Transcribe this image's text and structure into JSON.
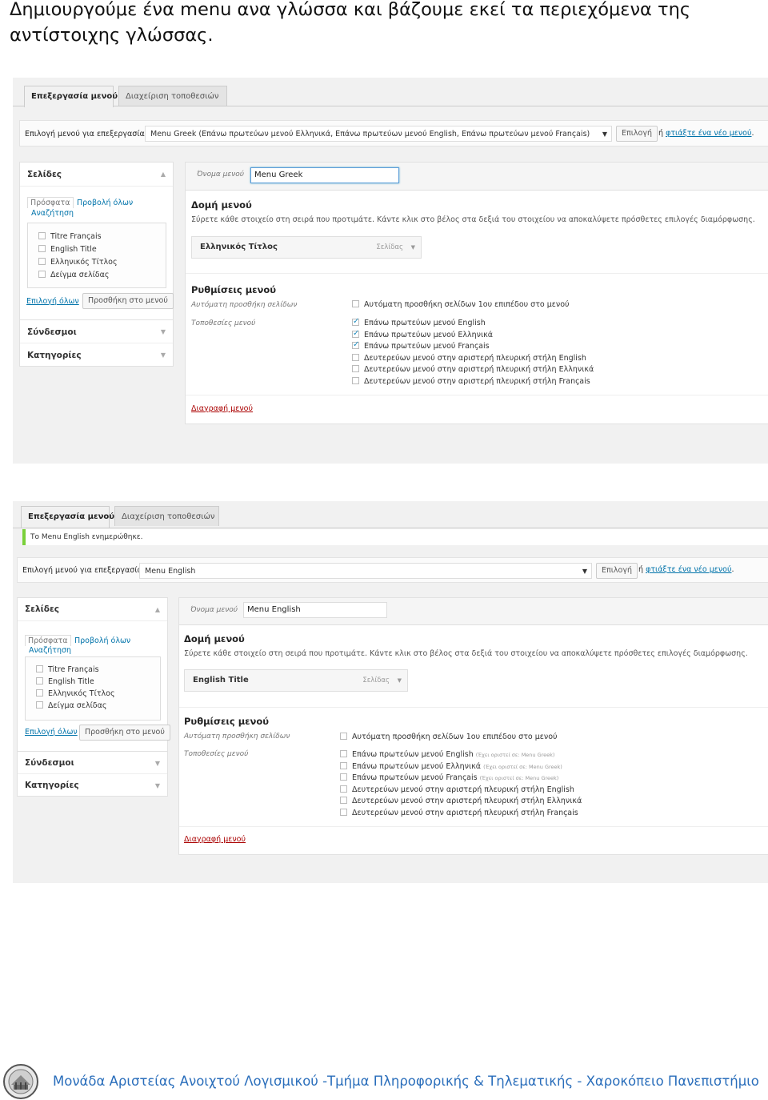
{
  "intro_text": "Δημιουργούμε ένα menu ανα γλώσσα και βάζουμε εκεί τα περιεχόμενα της αντίστοιχης γλώσσας.",
  "shot1": {
    "tabs": [
      "Επεξεργασία μενού",
      "Διαχείριση τοποθεσιών"
    ],
    "select_label": "Επιλογή μενού για επεξεργασία:",
    "select_value": "Menu Greek (Επάνω πρωτεύων μενού Ελληνικά, Επάνω πρωτεύων μενού English, Επάνω πρωτεύων μενού Français)",
    "select_button": "Επιλογή",
    "or_text": "ή",
    "create_link": "φτιάξτε ένα νέο μενού",
    "create_suffix": ".",
    "sidebar": {
      "pages_title": "Σελίδες",
      "subtab_recent": "Πρόσφατα",
      "subtab_all": "Προβολή όλων",
      "subtab_search": "Αναζήτηση",
      "pages": [
        "Titre Français",
        "English Title",
        "Ελληνικός Τίτλος",
        "Δείγμα σελίδας"
      ],
      "select_all": "Επιλογή όλων",
      "add_button": "Προσθήκη στο μενού",
      "links_title": "Σύνδεσμοι",
      "categories_title": "Κατηγορίες"
    },
    "menu_name_label": "Όνομα μενού",
    "menu_name_value": "Menu Greek",
    "structure_title": "Δομή μενού",
    "structure_desc": "Σύρετε κάθε στοιχείο στη σειρά που προτιμάτε. Κάντε κλικ στο βέλος στα δεξιά του στοιχείου να αποκαλύψετε πρόσθετες επιλογές διαμόρφωσης.",
    "item_title": "Ελληνικός Τίτλος",
    "item_type": "Σελίδας",
    "settings_title": "Ρυθμίσεις μενού",
    "auto_add_label": "Αυτόματη προσθήκη σελίδων",
    "auto_add_option": "Αυτόματη προσθήκη σελίδων 1ου επιπέδου στο μενού",
    "locations_label": "Τοποθεσίες μενού",
    "locations": [
      {
        "label": "Επάνω πρωτεύων μενού English",
        "checked": true
      },
      {
        "label": "Επάνω πρωτεύων μενού Ελληνικά",
        "checked": true
      },
      {
        "label": "Επάνω πρωτεύων μενού Français",
        "checked": true
      },
      {
        "label": "Δευτερεύων μενού στην αριστερή πλευρική στήλη English",
        "checked": false
      },
      {
        "label": "Δευτερεύων μενού στην αριστερή πλευρική στήλη Ελληνικά",
        "checked": false
      },
      {
        "label": "Δευτερεύων μενού στην αριστερή πλευρική στήλη Français",
        "checked": false
      }
    ],
    "delete_link": "Διαγραφή μενού"
  },
  "shot2": {
    "tabs": [
      "Επεξεργασία μενού",
      "Διαχείριση τοποθεσιών"
    ],
    "notice": "Το Menu English ενημερώθηκε.",
    "select_label": "Επιλογή μενού για επεξεργασία:",
    "select_value": "Menu English",
    "select_button": "Επιλογή",
    "or_text": "ή",
    "create_link": "φτιάξτε ένα νέο μενού",
    "create_suffix": ".",
    "sidebar": {
      "pages_title": "Σελίδες",
      "subtab_recent": "Πρόσφατα",
      "subtab_all": "Προβολή όλων",
      "subtab_search": "Αναζήτηση",
      "pages": [
        "Titre Français",
        "English Title",
        "Ελληνικός Τίτλος",
        "Δείγμα σελίδας"
      ],
      "select_all": "Επιλογή όλων",
      "add_button": "Προσθήκη στο μενού",
      "links_title": "Σύνδεσμοι",
      "categories_title": "Κατηγορίες"
    },
    "menu_name_label": "Όνομα μενού",
    "menu_name_value": "Menu English",
    "structure_title": "Δομή μενού",
    "structure_desc": "Σύρετε κάθε στοιχείο στη σειρά που προτιμάτε. Κάντε κλικ στο βέλος στα δεξιά του στοιχείου να αποκαλύψετε πρόσθετες επιλογές διαμόρφωσης.",
    "item_title": "English Title",
    "item_type": "Σελίδας",
    "settings_title": "Ρυθμίσεις μενού",
    "auto_add_label": "Αυτόματη προσθήκη σελίδων",
    "auto_add_option": "Αυτόματη προσθήκη σελίδων 1ου επιπέδου στο μενού",
    "locations_label": "Τοποθεσίες μενού",
    "locations": [
      {
        "label": "Επάνω πρωτεύων μενού English",
        "note": "(Έχει οριστεί σε: Menu Greek)",
        "checked": false
      },
      {
        "label": "Επάνω πρωτεύων μενού Ελληνικά",
        "note": "(Έχει οριστεί σε: Menu Greek)",
        "checked": false
      },
      {
        "label": "Επάνω πρωτεύων μενού Français",
        "note": "(Έχει οριστεί σε: Menu Greek)",
        "checked": false
      },
      {
        "label": "Δευτερεύων μενού στην αριστερή πλευρική στήλη English",
        "note": "",
        "checked": false
      },
      {
        "label": "Δευτερεύων μενού στην αριστερή πλευρική στήλη Ελληνικά",
        "note": "",
        "checked": false
      },
      {
        "label": "Δευτερεύων μενού στην αριστερή πλευρική στήλη Français",
        "note": "",
        "checked": false
      }
    ],
    "delete_link": "Διαγραφή μενού"
  },
  "footer_text": "Μονάδα Αριστείας Ανοιχτού Λογισμικού  -Τμήμα Πληροφορικής & Τηλεματικής - Χαροκόπειο Πανεπιστήμιο",
  "colors": {
    "link": "#0073aa",
    "notice": "#7ad03a",
    "footer": "#2a6ebb",
    "delete": "#a00000"
  }
}
